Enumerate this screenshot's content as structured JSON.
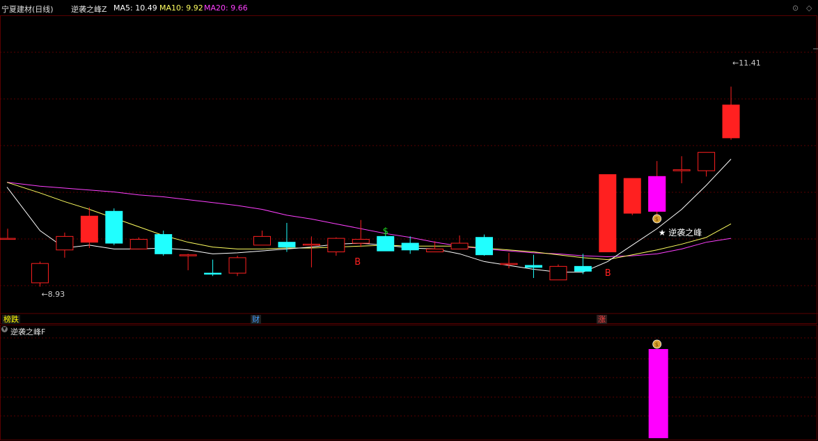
{
  "header": {
    "stock_title": "宁夏建材(日线)",
    "indicator_name": "逆袭之峰Z",
    "ma5_label": "MA5: 10.49",
    "ma10_label": "MA10: 9.92",
    "ma20_label": "MA20: 9.66",
    "right_icons": [
      "⊙",
      "◇"
    ]
  },
  "colors": {
    "up": "#ff2020",
    "down": "#20ffff",
    "ma5": "#ffffff",
    "ma10": "#ffff60",
    "ma20": "#ff40ff",
    "grid": "#5a0000",
    "signal_bar": "#ff00ff",
    "buy_text": "#ff2020",
    "dollar": "#20dd20"
  },
  "annotations": {
    "low_label": "8.93",
    "high_label": "11.41",
    "star_label": "★ 逆袭之峰",
    "buy_letter": "B",
    "dollar_sign": "$",
    "bag_icon": "money-bag-icon"
  },
  "event_markers": [
    {
      "label": "榜跌",
      "color": "#ffff00",
      "bg": "#1a1a1a"
    },
    {
      "label": "财",
      "color": "#40a0ff",
      "bg": "#202020"
    },
    {
      "label": "涨",
      "color": "#ff4040",
      "bg": "#302020"
    }
  ],
  "sub_panel": {
    "title": "逆袭之峰F"
  },
  "chart_data": {
    "type": "candlestick",
    "y_range": [
      8.7,
      11.8
    ],
    "candles": [
      {
        "o": 9.42,
        "c": 9.42,
        "h": 9.52,
        "l": 9.42
      },
      {
        "o": 8.96,
        "c": 9.16,
        "h": 9.18,
        "l": 8.92
      },
      {
        "o": 9.3,
        "c": 9.44,
        "h": 9.48,
        "l": 9.22
      },
      {
        "o": 9.38,
        "c": 9.65,
        "h": 9.74,
        "l": 9.32
      },
      {
        "o": 9.7,
        "c": 9.37,
        "h": 9.73,
        "l": 9.35
      },
      {
        "o": 9.31,
        "c": 9.41,
        "h": 9.43,
        "l": 9.31
      },
      {
        "o": 9.46,
        "c": 9.26,
        "h": 9.5,
        "l": 9.24
      },
      {
        "o": 9.24,
        "c": 9.25,
        "h": 9.26,
        "l": 9.09
      },
      {
        "o": 9.06,
        "c": 9.05,
        "h": 9.2,
        "l": 9.03
      },
      {
        "o": 9.06,
        "c": 9.22,
        "h": 9.24,
        "l": 9.03
      },
      {
        "o": 9.35,
        "c": 9.44,
        "h": 9.5,
        "l": 9.35
      },
      {
        "o": 9.38,
        "c": 9.33,
        "h": 9.58,
        "l": 9.28
      },
      {
        "o": 9.36,
        "c": 9.36,
        "h": 9.44,
        "l": 9.12
      },
      {
        "o": 9.28,
        "c": 9.42,
        "h": 9.43,
        "l": 9.24
      },
      {
        "o": 9.37,
        "c": 9.41,
        "h": 9.61,
        "l": 9.33
      },
      {
        "o": 9.44,
        "c": 9.29,
        "h": 9.5,
        "l": 9.29
      },
      {
        "o": 9.37,
        "c": 9.3,
        "h": 9.44,
        "l": 9.26
      },
      {
        "o": 9.28,
        "c": 9.31,
        "h": 9.39,
        "l": 9.29
      },
      {
        "o": 9.31,
        "c": 9.37,
        "h": 9.45,
        "l": 9.31
      },
      {
        "o": 9.43,
        "c": 9.25,
        "h": 9.46,
        "l": 9.24
      },
      {
        "o": 9.16,
        "c": 9.16,
        "h": 9.27,
        "l": 9.11
      },
      {
        "o": 9.14,
        "c": 9.12,
        "h": 9.25,
        "l": 9.01
      },
      {
        "o": 8.99,
        "c": 9.13,
        "h": 9.15,
        "l": 8.99
      },
      {
        "o": 9.13,
        "c": 9.08,
        "h": 9.26,
        "l": 9.05
      },
      {
        "o": 9.28,
        "c": 10.08,
        "h": 10.08,
        "l": 9.28
      },
      {
        "o": 9.68,
        "c": 10.04,
        "h": 10.04,
        "l": 9.66
      },
      {
        "o": 9.7,
        "c": 10.06,
        "h": 10.22,
        "l": 9.63
      },
      {
        "o": 10.12,
        "c": 10.13,
        "h": 10.27,
        "l": 9.99
      },
      {
        "o": 10.12,
        "c": 10.31,
        "h": 10.31,
        "l": 10.06
      },
      {
        "o": 10.46,
        "c": 10.8,
        "h": 10.99,
        "l": 10.44
      }
    ],
    "ma5": [
      9.95,
      9.5,
      9.32,
      9.35,
      9.31,
      9.31,
      9.32,
      9.3,
      9.26,
      9.27,
      9.29,
      9.31,
      9.33,
      9.36,
      9.37,
      9.35,
      9.32,
      9.31,
      9.26,
      9.18,
      9.14,
      9.1,
      9.07,
      9.07,
      9.18,
      9.35,
      9.52,
      9.72,
      9.97,
      10.24
    ],
    "ma10": [
      10.0,
      9.89,
      9.8,
      9.72,
      9.63,
      9.54,
      9.45,
      9.38,
      9.33,
      9.31,
      9.31,
      9.32,
      9.32,
      9.33,
      9.34,
      9.35,
      9.34,
      9.34,
      9.34,
      9.32,
      9.3,
      9.28,
      9.25,
      9.22,
      9.2,
      9.25,
      9.3,
      9.36,
      9.43,
      9.57
    ],
    "ma20": [
      10.0,
      9.96,
      9.94,
      9.92,
      9.9,
      9.87,
      9.85,
      9.82,
      9.79,
      9.76,
      9.72,
      9.66,
      9.62,
      9.57,
      9.52,
      9.47,
      9.43,
      9.38,
      9.34,
      9.31,
      9.29,
      9.27,
      9.26,
      9.24,
      9.23,
      9.24,
      9.26,
      9.31,
      9.38,
      9.42
    ],
    "signal_bar_index": 26
  }
}
